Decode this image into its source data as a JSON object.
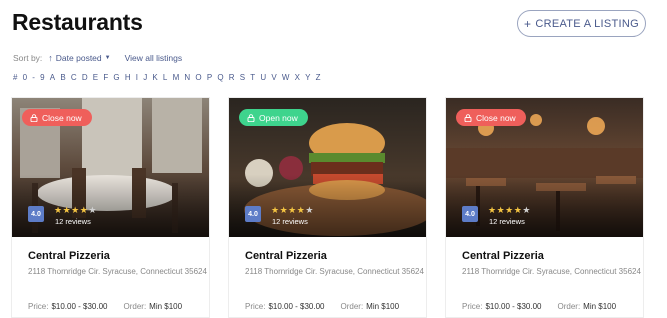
{
  "page": {
    "title": "Restaurants"
  },
  "toolbar": {
    "create_label": "CREATE A LISTING",
    "create_icon": "plus-icon"
  },
  "sort": {
    "label": "Sort by:",
    "value": "Date posted",
    "direction_icon": "arrow-up-icon",
    "view_all": "View all listings"
  },
  "alphabet": [
    "#",
    "0",
    "-",
    "9",
    "A",
    "B",
    "C",
    "D",
    "E",
    "F",
    "G",
    "H",
    "I",
    "J",
    "K",
    "L",
    "M",
    "N",
    "O",
    "P",
    "Q",
    "R",
    "S",
    "T",
    "U",
    "V",
    "W",
    "X",
    "Y",
    "Z"
  ],
  "colors": {
    "closed": "#ef5f5b",
    "open": "#3ed48d",
    "accent": "#4a5a8c",
    "rating": "#5d7cc7",
    "star": "#f5c542"
  },
  "cards": [
    {
      "status": "Close now",
      "status_type": "closed",
      "image": "restaurant-interior-photo",
      "rating": "4.0",
      "stars": 4,
      "reviews": "12 reviews",
      "name": "Central Pizzeria",
      "address": "2118 Thornridge Cir. Syracuse, Connecticut 35624",
      "price_label": "Price:",
      "price": "$10.00 - $30.00",
      "order_label": "Order:",
      "order": "Min $100"
    },
    {
      "status": "Open now",
      "status_type": "open",
      "image": "burger-photo",
      "rating": "4.0",
      "stars": 4,
      "reviews": "12 reviews",
      "name": "Central Pizzeria",
      "address": "2118 Thornridge Cir. Syracuse, Connecticut 35624",
      "price_label": "Price:",
      "price": "$10.00 - $30.00",
      "order_label": "Order:",
      "order": "Min $100"
    },
    {
      "status": "Close now",
      "status_type": "closed",
      "image": "restaurant-hall-photo",
      "rating": "4.0",
      "stars": 4,
      "reviews": "12 reviews",
      "name": "Central Pizzeria",
      "address": "2118 Thornridge Cir. Syracuse, Connecticut 35624",
      "price_label": "Price:",
      "price": "$10.00 - $30.00",
      "order_label": "Order:",
      "order": "Min $100"
    }
  ]
}
